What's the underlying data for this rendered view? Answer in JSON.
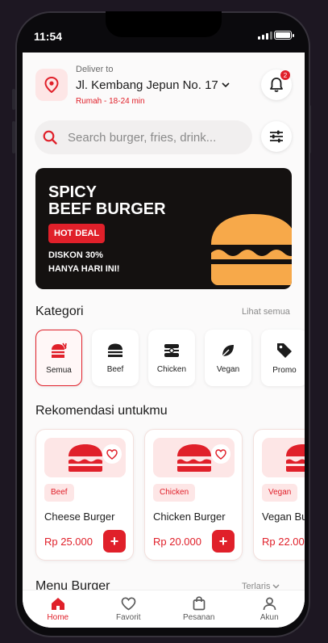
{
  "status_bar": {
    "time": "11:54"
  },
  "header": {
    "deliver_label": "Deliver to",
    "address": "Jl. Kembang Jepun No. 17",
    "eta": "Rumah - 18-24 min",
    "notification_count": "2"
  },
  "search": {
    "placeholder": "Search burger, fries, drink..."
  },
  "banner": {
    "title_line1": "SPICY",
    "title_line2": "BEEF BURGER",
    "badge": "HOT DEAL",
    "sub_line1": "DISKON 30%",
    "sub_line2": "HANYA HARI INI!"
  },
  "categories": {
    "title": "Kategori",
    "see_all": "Lihat semua",
    "items": [
      {
        "label": "Semua",
        "icon": "all-food-icon",
        "active": true
      },
      {
        "label": "Beef",
        "icon": "burger-icon"
      },
      {
        "label": "Chicken",
        "icon": "chicken-icon"
      },
      {
        "label": "Vegan",
        "icon": "leaf-icon"
      },
      {
        "label": "Promo",
        "icon": "tag-icon"
      }
    ]
  },
  "recommendations": {
    "title": "Rekomendasi untukmu",
    "items": [
      {
        "tag": "Beef",
        "name": "Cheese Burger",
        "price": "Rp 25.000"
      },
      {
        "tag": "Chicken",
        "name": "Chicken Burger",
        "price": "Rp 20.000"
      },
      {
        "tag": "Vegan",
        "name": "Vegan Burger",
        "price": "Rp 22.000"
      }
    ]
  },
  "menu_section": {
    "title": "Menu Burger",
    "sort": "Terlaris"
  },
  "bottom_nav": {
    "items": [
      {
        "label": "Home",
        "icon": "home-icon",
        "active": true
      },
      {
        "label": "Favorit",
        "icon": "heart-icon"
      },
      {
        "label": "Pesanan",
        "icon": "bag-icon"
      },
      {
        "label": "Akun",
        "icon": "user-icon"
      }
    ]
  },
  "colors": {
    "accent": "#e0202a",
    "accent_soft": "#fde6e6",
    "banner_bg": "#141110",
    "burger": "#f7a94a"
  }
}
